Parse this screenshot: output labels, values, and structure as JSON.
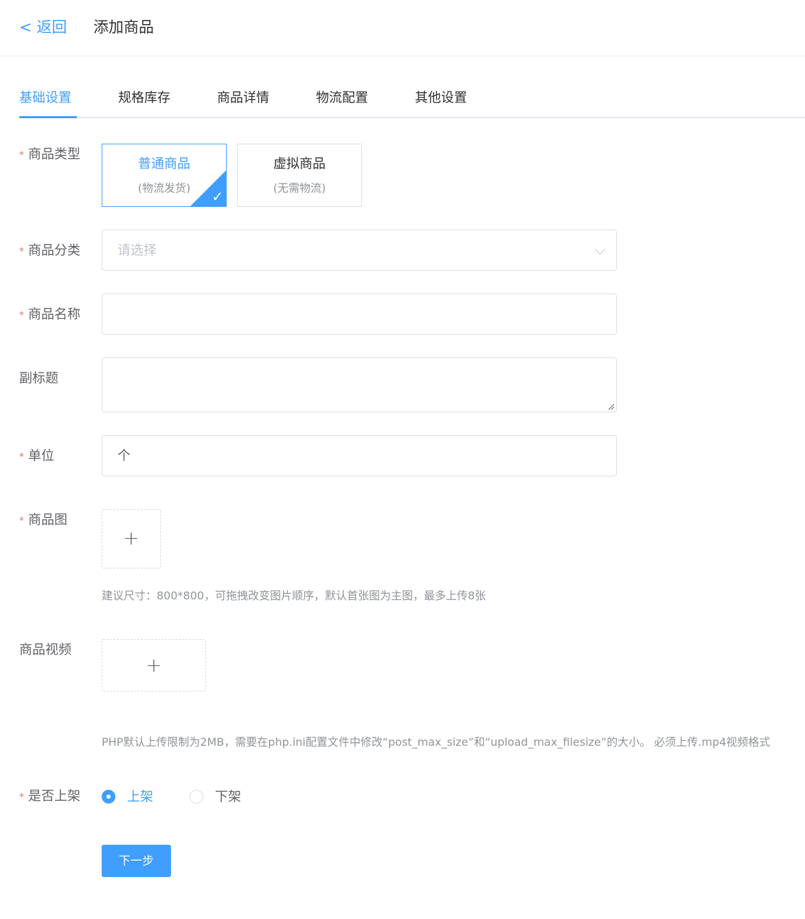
{
  "header": {
    "back_label": "< 返回",
    "title": "添加商品"
  },
  "tabs": [
    {
      "label": "基础设置",
      "active": true
    },
    {
      "label": "规格库存",
      "active": false
    },
    {
      "label": "商品详情",
      "active": false
    },
    {
      "label": "物流配置",
      "active": false
    },
    {
      "label": "其他设置",
      "active": false
    }
  ],
  "form": {
    "required_mark": "*",
    "product_type": {
      "label": "商品类型",
      "options": [
        {
          "title": "普通商品",
          "subtitle": "(物流发货)",
          "selected": true
        },
        {
          "title": "虚拟商品",
          "subtitle": "(无需物流)",
          "selected": false
        }
      ]
    },
    "category": {
      "label": "商品分类",
      "placeholder": "请选择"
    },
    "name": {
      "label": "商品名称",
      "value": ""
    },
    "subtitle": {
      "label": "副标题",
      "value": ""
    },
    "unit": {
      "label": "单位",
      "value": "个"
    },
    "images": {
      "label": "商品图",
      "hint": "建议尺寸：800*800，可拖拽改变图片顺序，默认首张图为主图，最多上传8张"
    },
    "video": {
      "label": "商品视频",
      "hint": "PHP默认上传限制为2MB，需要在php.ini配置文件中修改“post_max_size”和“upload_max_filesize”的大小。 必须上传.mp4视频格式"
    },
    "on_shelf": {
      "label": "是否上架",
      "options": [
        {
          "label": "上架",
          "checked": true
        },
        {
          "label": "下架",
          "checked": false
        }
      ]
    },
    "next_button": "下一步"
  },
  "colors": {
    "primary": "#409eff",
    "required": "#f56c6c",
    "border": "#dcdfe6",
    "hint": "#909399"
  }
}
